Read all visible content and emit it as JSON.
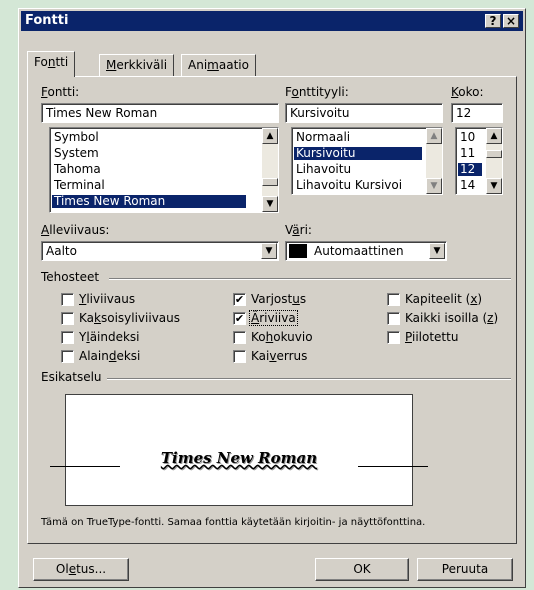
{
  "window": {
    "title": "Fontti",
    "help_label": "?",
    "close_label": "×"
  },
  "tabs": [
    {
      "pre": "Fo",
      "acc": "n",
      "post": "tti"
    },
    {
      "pre": "",
      "acc": "M",
      "post": "erkkiväli"
    },
    {
      "pre": "Ani",
      "acc": "m",
      "post": "aatio"
    }
  ],
  "font": {
    "label_acc": "F",
    "label_post": "ontti:",
    "value": "Times New Roman",
    "list": [
      "Symbol",
      "System",
      "Tahoma",
      "Terminal",
      "Times New Roman"
    ],
    "selected_index": 4
  },
  "style": {
    "label_pre": "F",
    "label_acc": "o",
    "label_post": "nttityyli:",
    "value": "Kursivoitu",
    "list": [
      "Normaali",
      "Kursivoitu",
      "Lihavoitu",
      "Lihavoitu Kursivoi"
    ],
    "selected_index": 1
  },
  "size": {
    "label_acc": "K",
    "label_post": "oko:",
    "value": "12",
    "list": [
      "10",
      "11",
      "12",
      "14"
    ],
    "selected_index": 2
  },
  "underline": {
    "label_acc": "A",
    "label_post": "lleviivaus:",
    "value": "Aalto"
  },
  "color": {
    "label_pre": "V",
    "label_acc": "ä",
    "label_post": "ri:",
    "value": "Automaattinen",
    "swatch": "#000000"
  },
  "effects": {
    "title": "Tehosteet",
    "items": [
      {
        "pre": "",
        "acc": "Y",
        "post": "liviivaus",
        "checked": false
      },
      {
        "pre": "Ka",
        "acc": "k",
        "post": "soisyliviivaus",
        "checked": false
      },
      {
        "pre": "Y",
        "acc": "l",
        "post": "äindeksi",
        "checked": false
      },
      {
        "pre": "Alain",
        "acc": "d",
        "post": "eksi",
        "checked": false
      },
      {
        "pre": "Varjost",
        "acc": "u",
        "post": "s",
        "checked": true
      },
      {
        "pre": "",
        "acc": "Ä",
        "post": "riviiva",
        "checked": true
      },
      {
        "pre": "Ko",
        "acc": "h",
        "post": "okuvio",
        "checked": false
      },
      {
        "pre": "Kai",
        "acc": "v",
        "post": "errus",
        "checked": false
      },
      {
        "pre": "Kapiteelit (",
        "acc": "x",
        "post": ")",
        "checked": false
      },
      {
        "pre": "Kaikki isoilla (",
        "acc": "z",
        "post": ")",
        "checked": false
      },
      {
        "pre": "",
        "acc": "P",
        "post": "iilotettu",
        "checked": false
      }
    ]
  },
  "preview": {
    "title": "Esikatselu",
    "sample": "Times New Roman",
    "note": "Tämä on TrueType-fontti. Samaa fonttia käytetään kirjoitin- ja näyttöfonttina."
  },
  "buttons": {
    "default": {
      "pre": "Ol",
      "acc": "e",
      "post": "tus..."
    },
    "ok": "OK",
    "cancel": "Peruuta"
  },
  "colors": {
    "title_bar": "#0a246a",
    "face": "#d4d0c8",
    "selection": "#0a246a",
    "background": "#d4e7d6"
  }
}
